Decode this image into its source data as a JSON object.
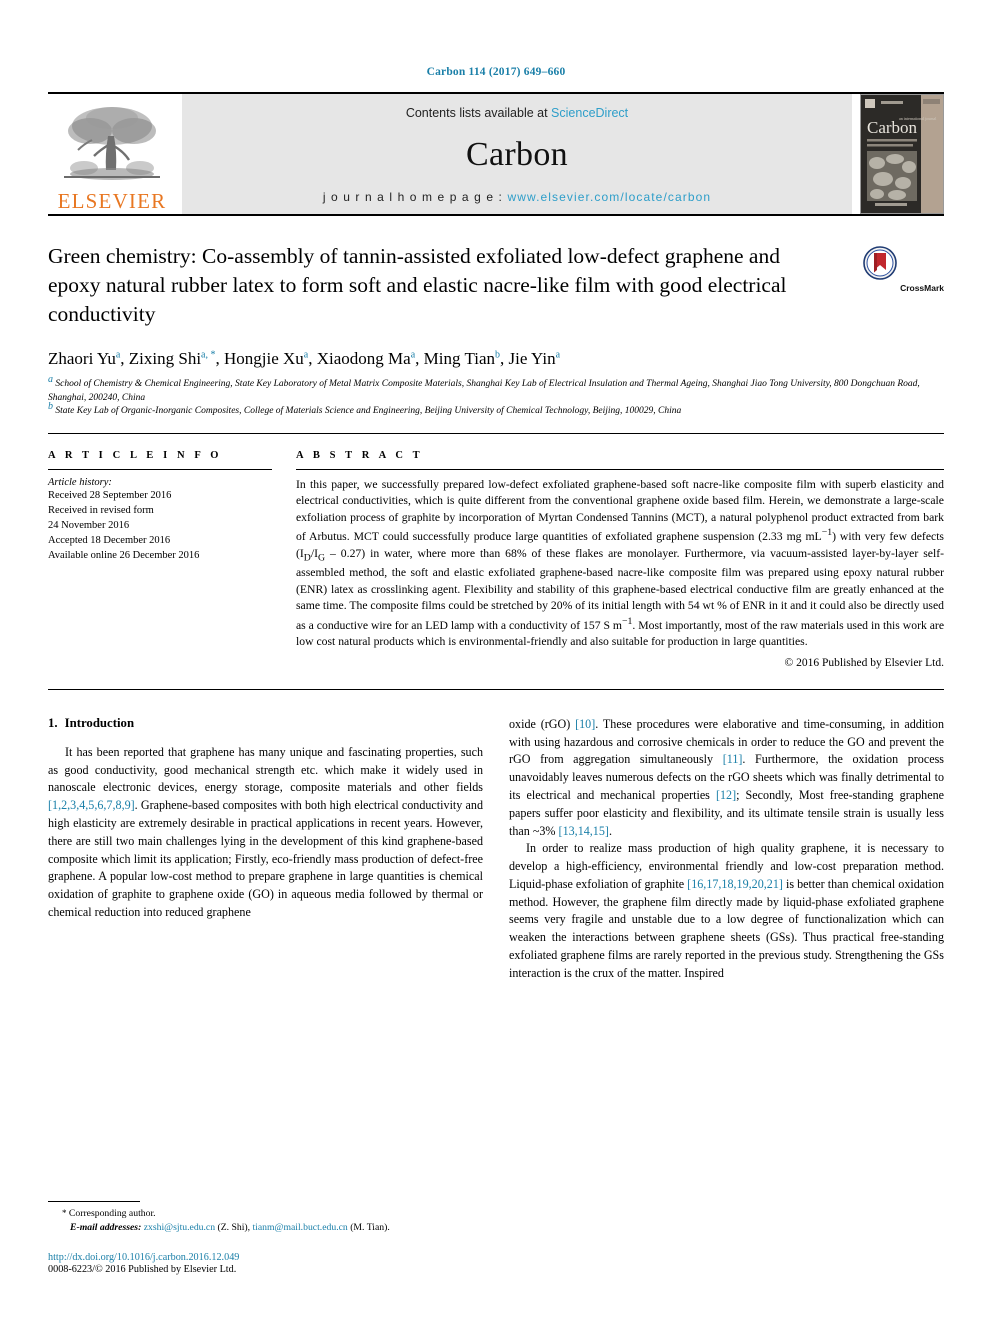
{
  "running_head": "Carbon 114 (2017) 649–660",
  "masthead": {
    "publisher": "ELSEVIER",
    "contents_prefix": "Contents lists available at ",
    "contents_link": "ScienceDirect",
    "journal_title": "Carbon",
    "homepage_prefix": "j o u r n a l   h o m e p a g e :  ",
    "homepage_url": "www.elsevier.com/locate/carbon",
    "cover_title": "Carbon",
    "link_color": "#2e9ec9",
    "elsevier_orange": "#E87722"
  },
  "article": {
    "title": "Green chemistry: Co-assembly of tannin-assisted exfoliated low-defect graphene and epoxy natural rubber latex to form soft and elastic nacre-like film with good electrical conductivity",
    "crossmark_label": "CrossMark",
    "authors": [
      {
        "name": "Zhaori Yu",
        "marks": "a",
        "sep": ", "
      },
      {
        "name": "Zixing Shi",
        "marks": "a, *",
        "sep": ", "
      },
      {
        "name": "Hongjie Xu",
        "marks": "a",
        "sep": ", "
      },
      {
        "name": "Xiaodong Ma",
        "marks": "a",
        "sep": ", "
      },
      {
        "name": "Ming Tian",
        "marks": "b",
        "sep": ", "
      },
      {
        "name": "Jie Yin",
        "marks": "a",
        "sep": ""
      }
    ],
    "affiliations": [
      {
        "mark": "a",
        "text": "School of Chemistry & Chemical Engineering, State Key Laboratory of Metal Matrix Composite Materials, Shanghai Key Lab of Electrical Insulation and Thermal Ageing, Shanghai Jiao Tong University, 800 Dongchuan Road, Shanghai, 200240, China"
      },
      {
        "mark": "b",
        "text": "State Key Lab of Organic-Inorganic Composites, College of Materials Science and Engineering, Beijing University of Chemical Technology, Beijing, 100029, China"
      }
    ]
  },
  "article_info": {
    "label": "A R T I C L E   I N F O",
    "history_label": "Article history:",
    "history": [
      "Received 28 September 2016",
      "Received in revised form",
      "24 November 2016",
      "Accepted 18 December 2016",
      "Available online 26 December 2016"
    ]
  },
  "abstract": {
    "label": "A B S T R A C T",
    "text_part1": "In this paper, we successfully prepared low-defect exfoliated graphene-based soft nacre-like composite film with superb elasticity and electrical conductivities, which is quite different from the conventional graphene oxide based film. Herein, we demonstrate a large-scale exfoliation process of graphite by incorporation of Myrtan Condensed Tannins (MCT), a natural polyphenol product extracted from bark of Arbutus. MCT could successfully produce large quantities of exfoliated graphene suspension (2.33 mg mL",
    "sup1": "−1",
    "text_part2": ") with very few defects (I",
    "sub1": "D",
    "text_part3": "/I",
    "sub2": "G",
    "text_part4": " – 0.27) in water, where more than 68% of these flakes are monolayer. Furthermore, via vacuum-assisted layer-by-layer self-assembled method, the soft and elastic exfoliated graphene-based nacre-like composite film was prepared using epoxy natural rubber (ENR) latex as crosslinking agent. Flexibility and stability of this graphene-based electrical conductive film are greatly enhanced at the same time. The composite films could be stretched by 20% of its initial length with 54 wt % of ENR in it and it could also be directly used as a conductive wire for an LED lamp with a conductivity of 157 S m",
    "sup2": "−1",
    "text_part5": ". Most importantly, most of the raw materials used in this work are low cost natural products which is environmental-friendly and also suitable for production in large quantities.",
    "copyright": "© 2016 Published by Elsevier Ltd."
  },
  "body": {
    "section_number": "1.",
    "section_title": "Introduction",
    "left_para1_a": "It has been reported that graphene has many unique and fascinating properties, such as good conductivity, good mechanical strength etc. which make it widely used in nanoscale electronic devices, energy storage, composite materials and other fields ",
    "left_ref1": "[1,2,3,4,5,6,7,8,9]",
    "left_para1_b": ". Graphene-based composites with both high electrical conductivity and high elasticity are extremely desirable in practical applications in recent years. However, there are still two main challenges lying in the development of this kind graphene-based composite which limit its application; Firstly, eco-friendly mass production of defect-free graphene. A popular low-cost method to prepare graphene in large quantities is chemical oxidation of graphite to graphene oxide (GO) in aqueous media followed by thermal or chemical reduction into reduced graphene",
    "right_para1_a": "oxide (rGO) ",
    "right_ref1": "[10]",
    "right_para1_b": ". These procedures were elaborative and time-consuming, in addition with using hazardous and corrosive chemicals in order to reduce the GO and prevent the rGO from aggregation simultaneously ",
    "right_ref2": "[11]",
    "right_para1_c": ". Furthermore, the oxidation process unavoidably leaves numerous defects on the rGO sheets which was finally detrimental to its electrical and mechanical properties ",
    "right_ref3": "[12]",
    "right_para1_d": "; Secondly, Most free-standing graphene papers suffer poor elasticity and flexibility, and its ultimate tensile strain is usually less than ~3% ",
    "right_ref4": "[13,14,15]",
    "right_para1_e": ".",
    "right_para2_a": "In order to realize mass production of high quality graphene, it is necessary to develop a high-efficiency, environmental friendly and low-cost preparation method. Liquid-phase exfoliation of graphite ",
    "right_ref5": "[16,17,18,19,20,21]",
    "right_para2_b": " is better than chemical oxidation method. However, the graphene film directly made by liquid-phase exfoliated graphene seems very fragile and unstable due to a low degree of functionalization which can weaken the interactions between graphene sheets (GSs). Thus practical free-standing exfoliated graphene films are rarely reported in the previous study. Strengthening the GSs interaction is the crux of the matter. Inspired"
  },
  "footer": {
    "corresponding_star": "*",
    "corresponding_text": "Corresponding author.",
    "email_label": "E-mail addresses:",
    "email1": "zxshi@sjtu.edu.cn",
    "email1_owner": "(Z. Shi),",
    "email2": "tianm@mail.buct.edu.cn",
    "email2_owner": "(M. Tian).",
    "doi": "http://dx.doi.org/10.1016/j.carbon.2016.12.049",
    "issn": "0008-6223/© 2016 Published by Elsevier Ltd."
  }
}
